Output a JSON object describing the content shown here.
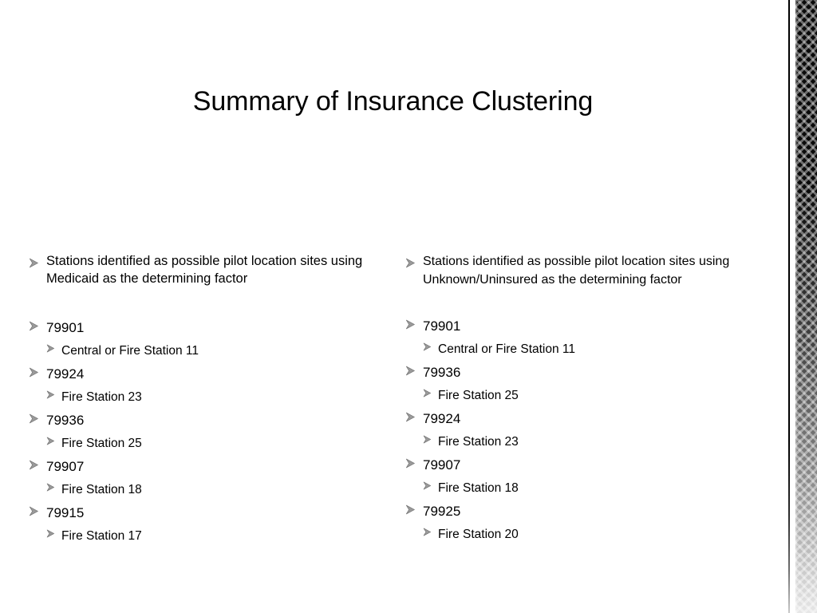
{
  "slide": {
    "title": "Summary of Insurance Clustering",
    "background_color": "#FFFFFF",
    "text_color": "#000000",
    "bullet_color": "#808080"
  },
  "columns": {
    "left": {
      "header": "Stations identified as possible pilot location sites using Medicaid as the determining factor",
      "groups": [
        {
          "zip": "79901",
          "station": "Central or Fire Station 11"
        },
        {
          "zip": "79924",
          "station": "Fire Station 23"
        },
        {
          "zip": "79936",
          "station": "Fire Station 25"
        },
        {
          "zip": "79907",
          "station": "Fire Station 18"
        },
        {
          "zip": "79915",
          "station": "Fire Station 17"
        }
      ]
    },
    "right": {
      "header": "Stations identified as possible pilot location sites using Unknown/Uninsured as the determining factor",
      "groups": [
        {
          "zip": "79901",
          "station": "Central or Fire Station 11"
        },
        {
          "zip": "79936",
          "station": "Fire Station 25"
        },
        {
          "zip": "79924",
          "station": "Fire Station 23"
        },
        {
          "zip": "79907",
          "station": "Fire Station 18"
        },
        {
          "zip": "79925",
          "station": "Fire Station 20"
        }
      ]
    }
  },
  "decoration": {
    "edge_rule_color": "#000000",
    "edge_band_color": "#0A0A0A",
    "edge_band_pattern": "diamond-weave-texture"
  }
}
